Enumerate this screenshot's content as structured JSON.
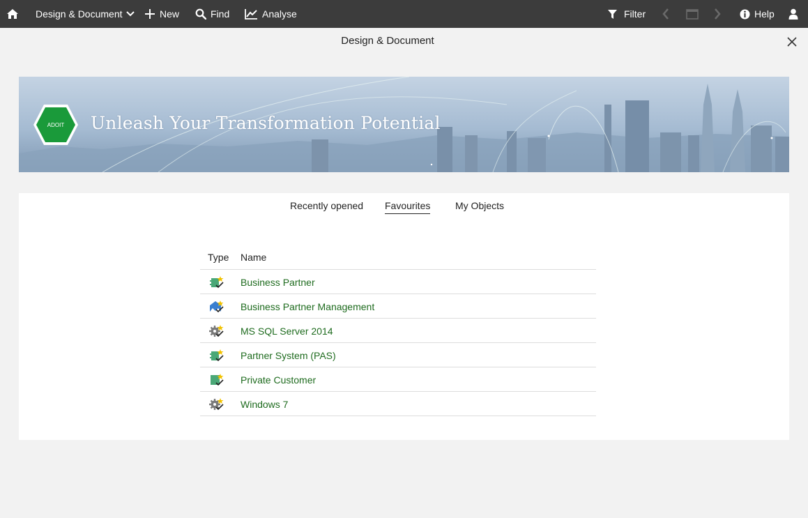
{
  "topbar": {
    "home_icon": "home-icon",
    "app_menu_label": "Design & Document",
    "new_label": "New",
    "find_label": "Find",
    "analyse_label": "Analyse",
    "filter_label": "Filter",
    "help_label": "Help",
    "background_color": "#3c3c3c"
  },
  "page": {
    "title": "Design & Document"
  },
  "banner": {
    "logo_text": "ADOIT",
    "headline": "Unleash Your Transformation Potential",
    "logo_color": "#1a9a3a"
  },
  "tabs": [
    {
      "label": "Recently opened",
      "active": false
    },
    {
      "label": "Favourites",
      "active": true
    },
    {
      "label": "My Objects",
      "active": false
    }
  ],
  "table": {
    "columns": [
      "Type",
      "Name"
    ],
    "rows": [
      {
        "icon": "application-component-icon",
        "name": "Business Partner"
      },
      {
        "icon": "business-process-icon",
        "name": "Business Partner Management"
      },
      {
        "icon": "technology-gear-icon",
        "name": "MS SQL Server 2014"
      },
      {
        "icon": "application-component-icon",
        "name": "Partner System (PAS)"
      },
      {
        "icon": "data-object-icon",
        "name": "Private Customer"
      },
      {
        "icon": "technology-gear-icon",
        "name": "Windows 7"
      }
    ],
    "link_color": "#1e6b1e"
  }
}
